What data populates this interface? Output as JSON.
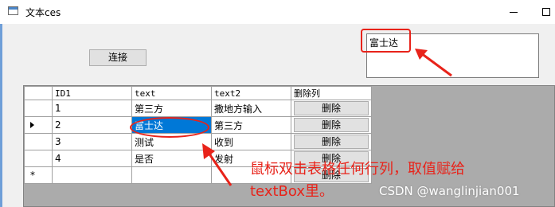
{
  "window": {
    "title": "文本ces",
    "icon": "app-window-icon",
    "minimize_icon": "minimize-icon",
    "maximize_icon": "maximize-icon"
  },
  "connect_button": {
    "label": "连接"
  },
  "textbox": {
    "value": "富士达"
  },
  "grid": {
    "columns": [
      "ID1",
      "text",
      "text2",
      "删除列"
    ],
    "rows": [
      {
        "id": "1",
        "text": "第三方",
        "text2": " 撒地方输入",
        "delete_label": "删除"
      },
      {
        "id": "2",
        "text": "富士达",
        "text2": "第三方",
        "delete_label": "删除"
      },
      {
        "id": "3",
        "text": "测试",
        "text2": "收到",
        "delete_label": "删除"
      },
      {
        "id": "4",
        "text": "是否",
        "text2": "发射",
        "delete_label": "删除"
      }
    ],
    "new_row": {
      "marker": "*",
      "delete_label": "删除"
    },
    "selected_color": "#0078d7"
  },
  "annotation": {
    "text": "鼠标双击表格任何行列，取值赋给textBox里。",
    "color": "#e8231a"
  },
  "watermark": "CSDN @wanglinjian001"
}
